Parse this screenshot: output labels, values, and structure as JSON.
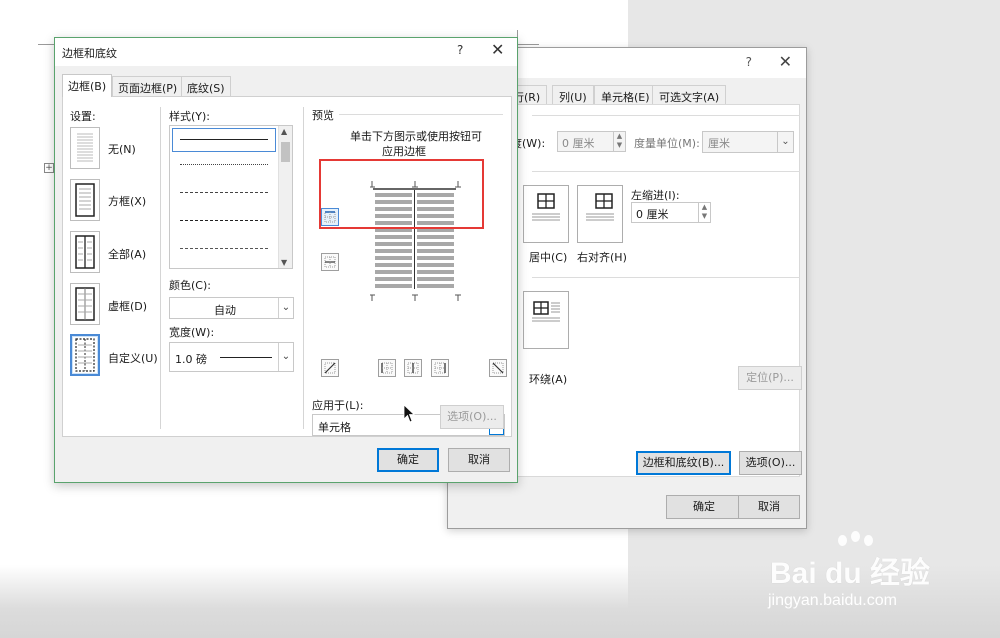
{
  "front_dialog": {
    "title": "边框和底纹",
    "help": "?",
    "close": "✕",
    "tabs": [
      "边框(B)",
      "页面边框(P)",
      "底纹(S)"
    ],
    "settings_label": "设置:",
    "settings": [
      "无(N)",
      "方框(X)",
      "全部(A)",
      "虚框(D)",
      "自定义(U)"
    ],
    "style_label": "样式(Y):",
    "color_label": "颜色(C):",
    "color_value": "自动",
    "width_label": "宽度(W):",
    "width_value": "1.0 磅",
    "preview_label": "预览",
    "preview_hint_1": "单击下方图示或使用按钮可",
    "preview_hint_2": "应用边框",
    "apply_label": "应用于(L):",
    "apply_value": "单元格",
    "options_button": "选项(O)...",
    "ok_button": "确定",
    "cancel_button": "取消"
  },
  "back_dialog": {
    "help": "?",
    "close": "✕",
    "tabs": [
      "行(R)",
      "列(U)",
      "单元格(E)",
      "可选文字(A)"
    ],
    "width_label": "度(W):",
    "width_value": "0 厘米",
    "unit_label": "度量单位(M):",
    "unit_value": "厘米",
    "indent_label": "左缩进(I):",
    "indent_value": "0 厘米",
    "align_center": "居中(C)",
    "align_right": "右对齐(H)",
    "wrap_around": "环绕(A)",
    "position_button": "定位(P)...",
    "borders_button": "边框和底纹(B)...",
    "options_button": "选项(O)...",
    "ok_button": "确定",
    "cancel_button": "取消"
  },
  "watermark": {
    "logo": "Bai du 经验",
    "url": "jingyan.baidu.com"
  },
  "colors": {
    "accent": "#0078d7",
    "highlight": "#e53935",
    "dialog_border": "#5aa36d"
  }
}
